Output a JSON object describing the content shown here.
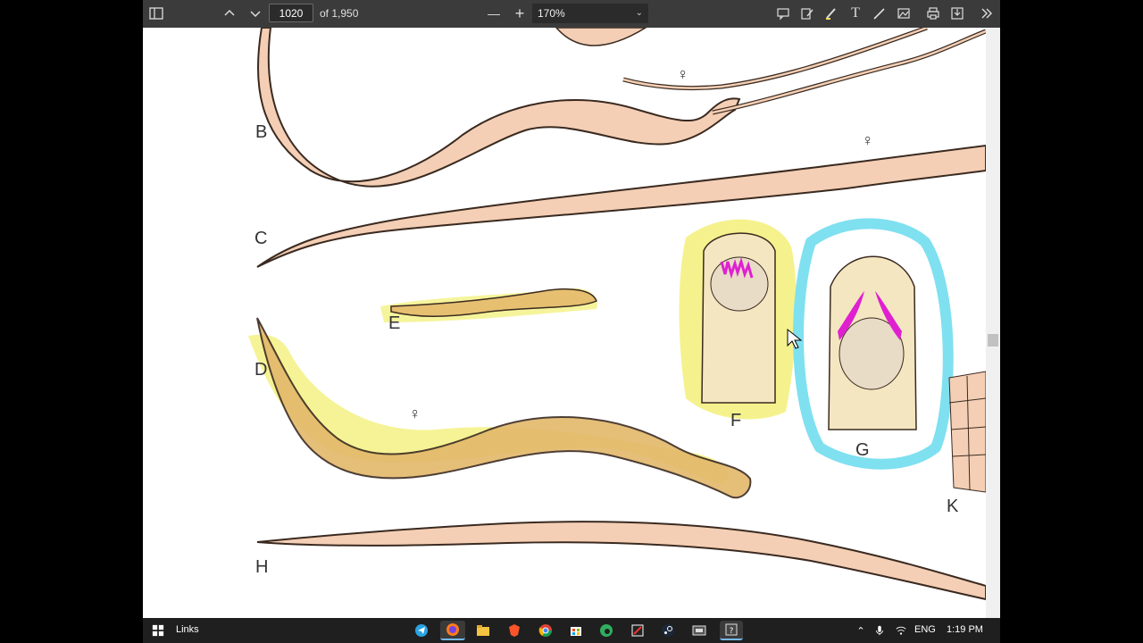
{
  "toolbar": {
    "page_number": "1020",
    "page_total": "of 1,950",
    "zoom_minus": "—",
    "zoom_plus": "+",
    "zoom_value": "170%",
    "icons": [
      "sidebar-icon",
      "page-up-icon",
      "page-down-icon",
      "comment-icon",
      "edit-icon",
      "highlight-icon",
      "text-icon",
      "draw-icon",
      "image-icon",
      "print-icon",
      "save-icon",
      "more-icon"
    ]
  },
  "figure": {
    "labels": [
      "B",
      "C",
      "D",
      "E",
      "F",
      "G",
      "H",
      "K"
    ],
    "female_symbol": "♀",
    "highlight_colors": {
      "yellow": "#f3f07a",
      "cyan": "#7fe0f0",
      "magenta": "#e020d0",
      "worm_fill": "#f4cfb5"
    }
  },
  "taskbar": {
    "links_label": "Links",
    "tray_lang": "ENG",
    "time": "1:19 PM",
    "scroll_position": 0.52
  }
}
